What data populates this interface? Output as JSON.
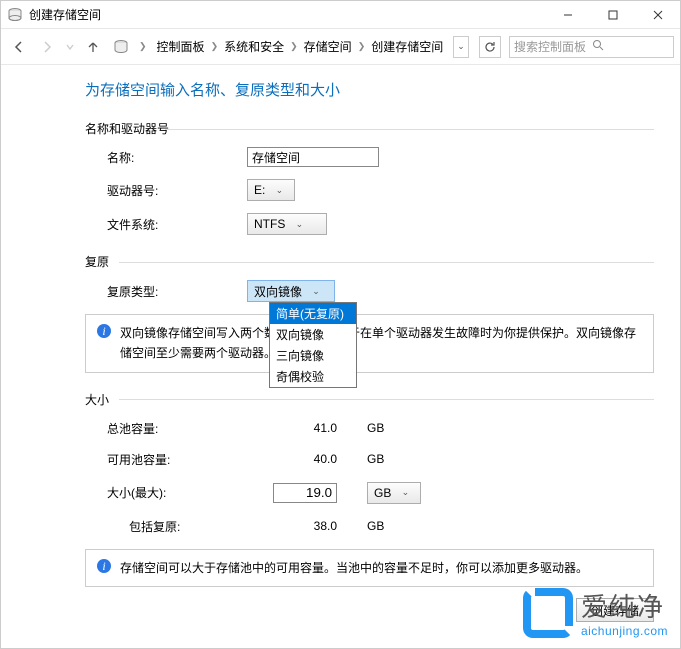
{
  "window": {
    "title": "创建存储空间"
  },
  "nav": {
    "breadcrumb": [
      "控制面板",
      "系统和安全",
      "存储空间",
      "创建存储空间"
    ],
    "search_placeholder": "搜索控制面板"
  },
  "page_title": "为存储空间输入名称、复原类型和大小",
  "sections": {
    "name_drive": {
      "header": "名称和驱动器号",
      "rows": {
        "name": {
          "label": "名称:",
          "value": "存储空间"
        },
        "drive": {
          "label": "驱动器号:",
          "value": "E:"
        },
        "fs": {
          "label": "文件系统:",
          "value": "NTFS"
        }
      }
    },
    "resiliency": {
      "header": "复原",
      "type_label": "复原类型:",
      "selected": "双向镜像",
      "options": [
        "简单(无复原)",
        "双向镜像",
        "三向镜像",
        "奇偶校验"
      ],
      "info": "双向镜像存储空间写入两个数据副本，有助于在单个驱动器发生故障时为你提供保护。双向镜像存储空间至少需要两个驱动器。"
    },
    "size": {
      "header": "大小",
      "rows": {
        "total_pool": {
          "label": "总池容量:",
          "value": "41.0",
          "unit": "GB"
        },
        "avail_pool": {
          "label": "可用池容量:",
          "value": "40.0",
          "unit": "GB"
        },
        "size_max": {
          "label": "大小(最大):",
          "value": "19.0",
          "unit": "GB"
        },
        "incl_resil": {
          "label": "包括复原:",
          "value": "38.0",
          "unit": "GB"
        }
      },
      "info": "存储空间可以大于存储池中的可用容量。当池中的容量不足时，你可以添加更多驱动器。"
    }
  },
  "footer": {
    "create_btn": "创建存储"
  },
  "watermark": {
    "cn": "爱纯净",
    "en": "aichunjing.com"
  }
}
